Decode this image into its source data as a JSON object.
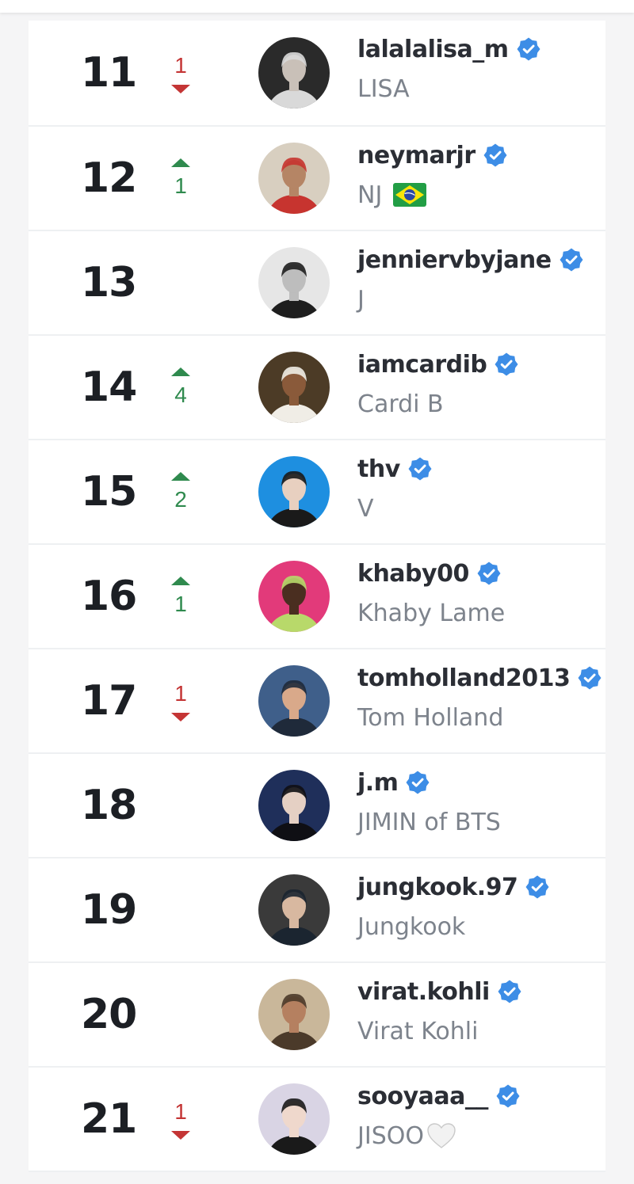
{
  "ranking": [
    {
      "rank": "11",
      "change": {
        "dir": "down",
        "value": "1"
      },
      "handle": "lalalalisa_m",
      "name": "LISA",
      "avatar": {
        "bg": "#2a2a2a",
        "fg": "#d9d9d9",
        "skin": "#c9c0b8"
      }
    },
    {
      "rank": "12",
      "change": {
        "dir": "up",
        "value": "1"
      },
      "handle": "neymarjr",
      "name": "NJ",
      "extra": "flag-brazil",
      "avatar": {
        "bg": "#d8cfc0",
        "fg": "#c7342f",
        "skin": "#b58565"
      }
    },
    {
      "rank": "13",
      "change": null,
      "handle": "jenniervbyjane",
      "name": "J",
      "avatar": {
        "bg": "#e6e6e6",
        "fg": "#1e1e1e",
        "skin": "#bdbdbd"
      }
    },
    {
      "rank": "14",
      "change": {
        "dir": "up",
        "value": "4"
      },
      "handle": "iamcardib",
      "name": "Cardi B",
      "avatar": {
        "bg": "#4c3b26",
        "fg": "#f0ede6",
        "skin": "#8a5a3a"
      }
    },
    {
      "rank": "15",
      "change": {
        "dir": "up",
        "value": "2"
      },
      "handle": "thv",
      "name": "V",
      "avatar": {
        "bg": "#1e8fe0",
        "fg": "#1a1a1a",
        "skin": "#e8d0c0"
      }
    },
    {
      "rank": "16",
      "change": {
        "dir": "up",
        "value": "1"
      },
      "handle": "khaby00",
      "name": "Khaby Lame",
      "avatar": {
        "bg": "#e23a7a",
        "fg": "#b8d96a",
        "skin": "#4a2e20"
      }
    },
    {
      "rank": "17",
      "change": {
        "dir": "down",
        "value": "1"
      },
      "handle": "tomholland2013",
      "name": "Tom Holland",
      "avatar": {
        "bg": "#3f5f8a",
        "fg": "#1f2a3a",
        "skin": "#d9a98a"
      }
    },
    {
      "rank": "18",
      "change": null,
      "handle": "j.m",
      "name": "JIMIN of BTS",
      "avatar": {
        "bg": "#1f2f5a",
        "fg": "#0f0f14",
        "skin": "#e5d0c4"
      }
    },
    {
      "rank": "19",
      "change": null,
      "handle": "jungkook.97",
      "name": "Jungkook",
      "avatar": {
        "bg": "#3a3a3a",
        "fg": "#1b2530",
        "skin": "#d8b8a0"
      }
    },
    {
      "rank": "20",
      "change": null,
      "handle": "virat.kohli",
      "name": "Virat Kohli",
      "avatar": {
        "bg": "#c9b79a",
        "fg": "#4b3a2a",
        "skin": "#b58060"
      }
    },
    {
      "rank": "21",
      "change": {
        "dir": "down",
        "value": "1"
      },
      "handle": "sooyaaa__",
      "name": "JISOO",
      "extra": "white-heart",
      "avatar": {
        "bg": "#d9d4e4",
        "fg": "#1a1a1a",
        "skin": "#efd8cc"
      }
    }
  ],
  "icons": {
    "verified": "verified-badge-icon",
    "up": "arrow-up-icon",
    "down": "arrow-down-icon"
  },
  "colors": {
    "verified": "#3d8de6",
    "up": "#2f8a4e",
    "down": "#c43535",
    "rank": "#1c1f24",
    "handle": "#2b2e35",
    "name": "#7d838c"
  }
}
